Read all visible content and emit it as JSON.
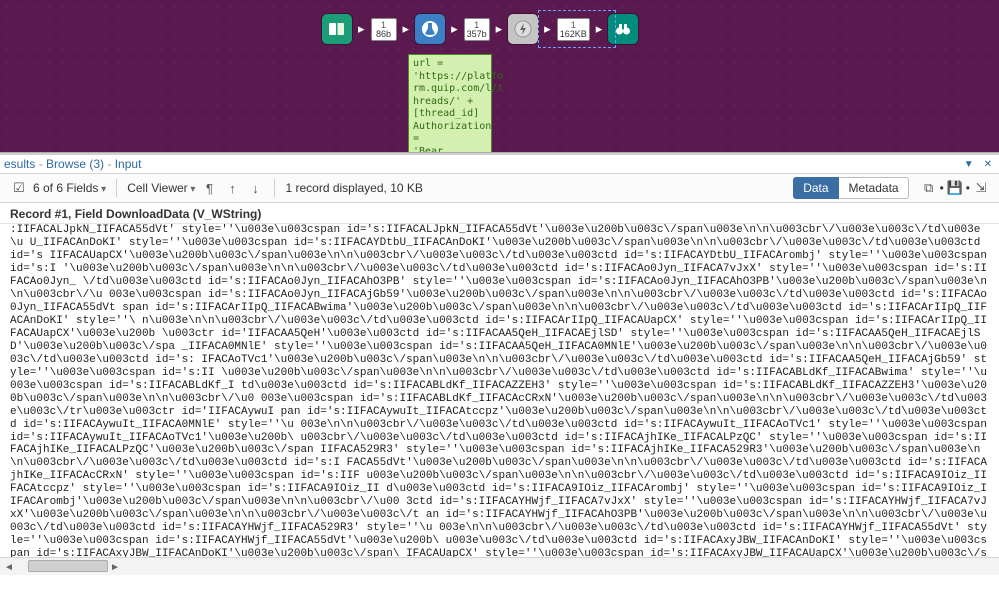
{
  "workflow": {
    "conn1": {
      "num": "1",
      "size": "86b"
    },
    "conn2": {
      "num": "1",
      "size": "357b"
    },
    "conn3": {
      "num": "1",
      "size": "162KB"
    },
    "annotation": "url =\n'https://platfo\nrm.quip.com/l/t\nhreads/' +\n[thread_id]\nAuthorization =\n'Bear..."
  },
  "browse": {
    "title_parts": {
      "a": "esults",
      "b": "Browse (3)",
      "c": "Input"
    },
    "sep": " - "
  },
  "toolbar": {
    "fields": "6 of 6 Fields",
    "cellviewer": "Cell Viewer",
    "pilcrow": "¶",
    "records": "1 record displayed, 10 KB",
    "data": "Data",
    "metadata": "Metadata"
  },
  "record": {
    "header": "Record #1, Field DownloadData (V_WString)",
    "body": ":IIFACALJpkN_IIFACA55dVt' style=''\\u003e\\u003cspan id='s:IIFACALJpkN_IIFACA55dVt'\\u003e\\u200b\\u003c\\/span\\u003e\\n\\n\\u003cbr\\/\\u003e\\u003c\\/td\\u003e\\u\nU_IIFACAnDoKI' style=''\\u003e\\u003cspan id='s:IIFACAYDtbU_IIFACAnDoKI'\\u003e\\u200b\\u003c\\/span\\u003e\\n\\n\\u003cbr\\/\\u003e\\u003c\\/td\\u003e\\u003ctd id='s\nIIFACAUapCX'\\u003e\\u200b\\u003c\\/span\\u003e\\n\\n\\u003cbr\\/\\u003e\\u003c\\/td\\u003e\\u003ctd id='s:IIFACAYDtbU_IIFACArombj' style=''\\u003e\\u003cspan id='s:I\n'\\u003e\\u200b\\u003c\\/span\\u003e\\n\\n\\u003cbr\\/\\u003e\\u003c\\/td\\u003e\\u003ctd id='s:IIFACAo0Jyn_IIFACA7vJxX' style=''\\u003e\\u003cspan id='s:IIFACAo0Jyn_\n\\/td\\u003e\\u003ctd id='s:IIFACAo0Jyn_IIFACAhO3PB' style=''\\u003e\\u003cspan id='s:IIFACAo0Jyn_IIFACAhO3PB'\\u003e\\u200b\\u003c\\/span\\u003e\\n\\n\\u003cbr\\/\\u\n003e\\u003cspan id='s:IIFACAo0Jyn_IIFACAjGb59'\\u003e\\u200b\\u003c\\/span\\u003e\\n\\n\\u003cbr\\/\\u003e\\u003c\\/td\\u003e\\u003ctd id='s:IIFACAo0Jyn_IIFACA55dVt\nspan id='s:IIFACArIIpQ_IIFACABwima'\\u003e\\u200b\\u003c\\/span\\u003e\\n\\n\\u003cbr\\/\\u003e\\u003c\\/td\\u003e\\u003ctd id='s:IIFACArIIpQ_IIFACAnDoKI' style=''\\\nn\\u003e\\n\\n\\u003cbr\\/\\u003e\\u003c\\/td\\u003e\\u003ctd id='s:IIFACArIIpQ_IIFACAUapCX' style=''\\u003e\\u003cspan id='s:IIFACArIIpQ_IIFACAUapCX'\\u003e\\u200b\n\\u003ctr id='IIFACAA5QeH'\\u003e\\u003ctd id='s:IIFACAA5QeH_IIFACAEjlSD' style=''\\u003e\\u003cspan id='s:IIFACAA5QeH_IIFACAEjlSD'\\u003e\\u200b\\u003c\\/spa\n_IIFACA0MNlE' style=''\\u003e\\u003cspan id='s:IIFACAA5QeH_IIFACA0MNlE'\\u003e\\u200b\\u003c\\/span\\u003e\\n\\n\\u003cbr\\/\\u003e\\u003c\\/td\\u003e\\u003ctd id='s:\nIFACAoTVc1'\\u003e\\u200b\\u003c\\/span\\u003e\\n\\n\\u003cbr\\/\\u003e\\u003c\\/td\\u003e\\u003ctd id='s:IIFACAA5QeH_IIFACAjGb59' style=''\\u003e\\u003cspan id='s:II\n\\u003e\\u200b\\u003c\\/span\\u003e\\n\\n\\u003cbr\\/\\u003e\\u003c\\/td\\u003e\\u003ctd id='s:IIFACABLdKf_IIFACABwima' style=''\\u003e\\u003cspan id='s:IIFACABLdKf_I\ntd\\u003e\\u003ctd id='s:IIFACABLdKf_IIFACAZZEH3' style=''\\u003e\\u003cspan id='s:IIFACABLdKf_IIFACAZZEH3'\\u003e\\u200b\\u003c\\/span\\u003e\\n\\n\\u003cbr\\/\\u0\n003e\\u003cspan id='s:IIFACABLdKf_IIFACAcCRxN'\\u003e\\u200b\\u003c\\/span\\u003e\\n\\n\\u003cbr\\/\\u003e\\u003c\\/td\\u003e\\u003c\\/tr\\u003e\\u003ctr id='IIFACAywuI\npan id='s:IIFACAywuIt_IIFACAtccpz'\\u003e\\u200b\\u003c\\/span\\u003e\\n\\n\\u003cbr\\/\\u003e\\u003c\\/td\\u003e\\u003ctd id='s:IIFACAywuIt_IIFACA0MNlE' style=''\\u\n003e\\n\\n\\u003cbr\\/\\u003e\\u003c\\/td\\u003e\\u003ctd id='s:IIFACAywuIt_IIFACAoTVc1' style=''\\u003e\\u003cspan id='s:IIFACAywuIt_IIFACAoTVc1'\\u003e\\u200b\\\nu003cbr\\/\\u003e\\u003c\\/td\\u003e\\u003ctd id='s:IIFACAjhIKe_IIFACALPzQC' style=''\\u003e\\u003cspan id='s:IIFACAjhIKe_IIFACALPzQC'\\u003e\\u200b\\u003c\\/span\nIIFACA529R3' style=''\\u003e\\u003cspan id='s:IIFACAjhIKe_IIFACA529R3'\\u003e\\u200b\\u003c\\/span\\u003e\\n\\n\\u003cbr\\/\\u003e\\u003c\\/td\\u003e\\u003ctd id='s:I\nFACA55dVt'\\u003e\\u200b\\u003c\\/span\\u003e\\n\\n\\u003cbr\\/\\u003e\\u003c\\/td\\u003e\\u003ctd id='s:IIFACAjhIKe_IIFACAcCRxN' style=''\\u003e\\u003cspan id='s:IIF\nu003e\\u200b\\u003c\\/span\\u003e\\n\\n\\u003cbr\\/\\u003e\\u003c\\/td\\u003e\\u003ctd id='s:IIFACA9IOiz_IIFACAtccpz' style=''\\u003e\\u003cspan id='s:IIFACA9IOiz_II\nd\\u003e\\u003ctd id='s:IIFACA9IOiz_IIFACArombj' style=''\\u003e\\u003cspan id='s:IIFACA9IOiz_IIFACArombj'\\u003e\\u200b\\u003c\\/span\\u003e\\n\\n\\u003cbr\\/\\u00\n3ctd id='s:IIFACAYHWjf_IIFACA7vJxX' style=''\\u003e\\u003cspan id='s:IIFACAYHWjf_IIFACA7vJxX'\\u003e\\u200b\\u003c\\/span\\u003e\\n\\n\\u003cbr\\/\\u003e\\u003c\\/t\nan id='s:IIFACAYHWjf_IIFACAhO3PB'\\u003e\\u200b\\u003c\\/span\\u003e\\n\\n\\u003cbr\\/\\u003e\\u003c\\/td\\u003e\\u003ctd id='s:IIFACAYHWjf_IIFACA529R3' style=''\\u\n003e\\n\\n\\u003cbr\\/\\u003e\\u003c\\/td\\u003e\\u003ctd id='s:IIFACAYHWjf_IIFACA55dVt' style=''\\u003e\\u003cspan id='s:IIFACAYHWjf_IIFACA55dVt'\\u003e\\u200b\\\nu003e\\u003c\\/td\\u003e\\u003ctd id='s:IIFACAxyJBW_IIFACAnDoKI' style=''\\u003e\\u003cspan id='s:IIFACAxyJBW_IIFACAnDoKI'\\u003e\\u200b\\u003c\\/span\\\nIFACAUapCX' style=''\\u003e\\u003cspan id='s:IIFACAxyJBW_IIFACAUapCX'\\u003e\\u200b\\u003c\\/span\\u003e\\n\\n\\u003cbr\\/\\u003e\\u003c\\/td\\u003e\\u003ctd id='s:II"
  }
}
